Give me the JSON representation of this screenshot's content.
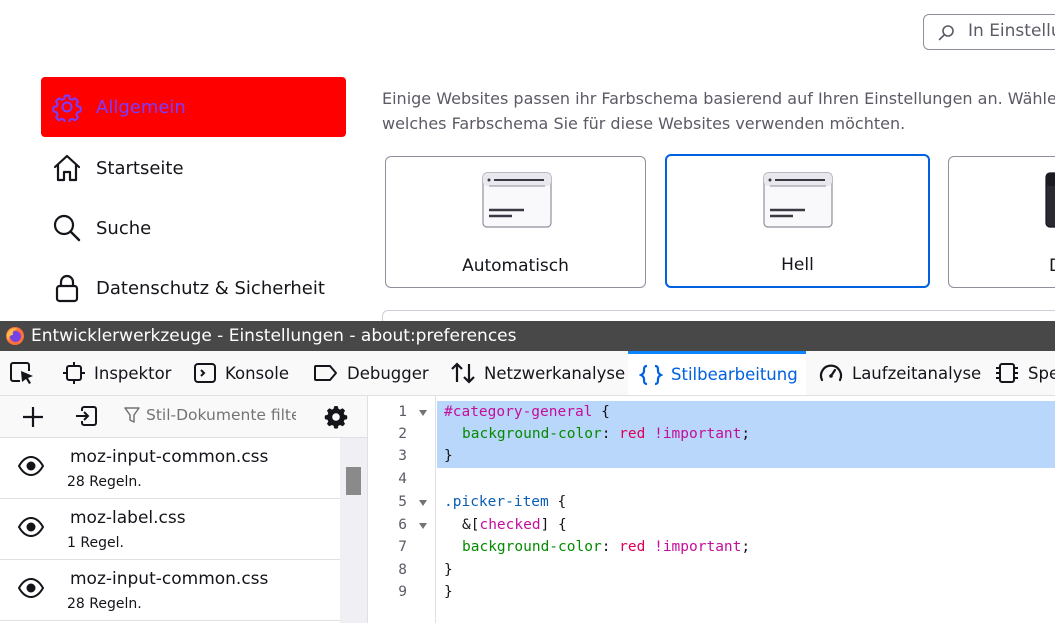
{
  "prefs": {
    "search": {
      "placeholder": "In Einstellungen suchen"
    },
    "nav": [
      {
        "label": "Allgemein",
        "icon": "gear-icon",
        "active": true
      },
      {
        "label": "Startseite",
        "icon": "home-icon",
        "active": false
      },
      {
        "label": "Suche",
        "icon": "search-icon",
        "active": false
      },
      {
        "label": "Datenschutz & Sicherheit",
        "icon": "lock-icon",
        "active": false
      }
    ],
    "intro_line1": "Einige Websites passen ihr Farbschema basierend auf Ihren Einstellungen an. Wählen Sie,",
    "intro_line2": "welches Farbschema Sie für diese Websites verwenden möchten.",
    "themes": [
      {
        "label": "Automatisch",
        "selected": false
      },
      {
        "label": "Hell",
        "selected": true
      },
      {
        "label": "Dunkel",
        "selected": false
      }
    ],
    "accent_color": "#ff0000",
    "active_text_color": "#7a3cff"
  },
  "devtools": {
    "title": "Entwicklerwerkzeuge - Einstellungen - about:preferences",
    "tabs": [
      {
        "label": "Inspektor",
        "icon": "inspector-icon"
      },
      {
        "label": "Konsole",
        "icon": "console-icon"
      },
      {
        "label": "Debugger",
        "icon": "debugger-icon"
      },
      {
        "label": "Netzwerkanalyse",
        "icon": "network-icon"
      },
      {
        "label": "Stilbearbeitung",
        "icon": "style-editor-icon",
        "active": true
      },
      {
        "label": "Laufzeitanalyse",
        "icon": "performance-icon"
      },
      {
        "label": "Speicher",
        "icon": "memory-icon"
      }
    ],
    "sidebar": {
      "filter_placeholder": "Stil-Dokumente filtern",
      "sheets": [
        {
          "name": "moz-input-common.css",
          "rules": "28 Regeln."
        },
        {
          "name": "moz-label.css",
          "rules": "1 Regel."
        },
        {
          "name": "moz-input-common.css",
          "rules": "28 Regeln."
        }
      ]
    },
    "editor": {
      "line_numbers": [
        "1",
        "2",
        "3",
        "4",
        "5",
        "6",
        "7",
        "8",
        "9"
      ],
      "l1_selector": "#category-general",
      "l1_brace": " {",
      "l2_prop": "background-color",
      "l2_colon": ": ",
      "l2_val": "red",
      "l2_imp": " !important",
      "l2_semi": ";",
      "l3": "}",
      "l5_selector": ".picker-item",
      "l5_brace": " {",
      "l6_amp": "&[",
      "l6_attr": "checked",
      "l6_rest": "] {",
      "l7_prop": "background-color",
      "l7_colon": ": ",
      "l7_val": "red",
      "l7_imp": " !important",
      "l7_semi": ";",
      "l8": "}",
      "l9": "}"
    }
  }
}
